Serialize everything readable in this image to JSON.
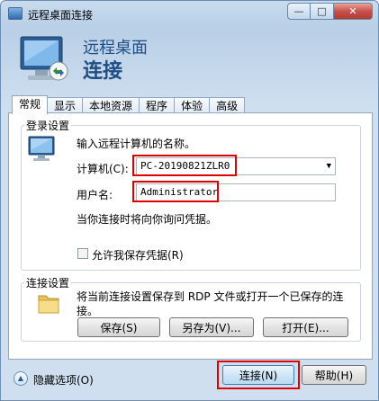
{
  "window": {
    "title": "远程桌面连接",
    "caption": {
      "minimize": "—",
      "maximize": "□",
      "close": "✕"
    }
  },
  "banner": {
    "line1": "远程桌面",
    "line2": "连接"
  },
  "tabs": [
    {
      "label": "常规",
      "active": true
    },
    {
      "label": "显示"
    },
    {
      "label": "本地资源"
    },
    {
      "label": "程序"
    },
    {
      "label": "体验"
    },
    {
      "label": "高级"
    }
  ],
  "login_settings": {
    "group_label": "登录设置",
    "prompt": "输入远程计算机的名称。",
    "computer_label": "计算机(C):",
    "computer_value": "PC-20190821ZLR0",
    "username_label": "用户名:",
    "username_value": "Administrator",
    "hint": "当你连接时将向你询问凭据。",
    "save_credentials_label": "允许我保存凭据(R)",
    "save_credentials_checked": false
  },
  "connection_settings": {
    "group_label": "连接设置",
    "description": "将当前连接设置保存到 RDP 文件或打开一个已保存的连接。",
    "save_label": "保存(S)",
    "save_as_label": "另存为(V)...",
    "open_label": "打开(E)..."
  },
  "footer": {
    "options_label": "隐藏选项(O)",
    "connect_label": "连接(N)",
    "help_label": "帮助(H)"
  },
  "icons": {
    "title": "remote-desktop-icon",
    "banner": "monitor-icon",
    "login": "monitor-icon",
    "folder": "folder-icon",
    "options": "chevron-up-icon"
  },
  "colors": {
    "highlight_box": "#e00000",
    "banner_text": "#1f4e86"
  }
}
